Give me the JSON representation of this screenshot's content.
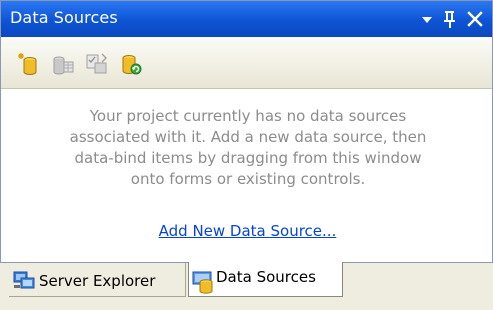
{
  "panel": {
    "title": "Data Sources",
    "buttons": {
      "dropdown_icon": "chevron-down-icon",
      "pin_icon": "pin-icon",
      "close_icon": "close-icon"
    }
  },
  "toolbar": {
    "items": [
      {
        "icon": "add-data-source-icon"
      },
      {
        "icon": "edit-dataset-icon"
      },
      {
        "icon": "configure-dataset-icon"
      },
      {
        "icon": "refresh-icon"
      }
    ]
  },
  "content": {
    "message_lines": [
      "Your project currently has no data sources",
      "associated with it. Add a new data source, then",
      "data-bind items by dragging from this window",
      "onto forms or existing controls."
    ],
    "link_text": "Add New Data Source..."
  },
  "tabs": [
    {
      "label": "Server Explorer",
      "icon": "server-explorer-icon",
      "active": false
    },
    {
      "label": "Data Sources",
      "icon": "data-sources-icon",
      "active": true
    }
  ],
  "colors": {
    "titlebar": "#0d54d4",
    "link": "#0645d8",
    "message": "#8c8c8c",
    "tabstrip": "#efede0"
  }
}
